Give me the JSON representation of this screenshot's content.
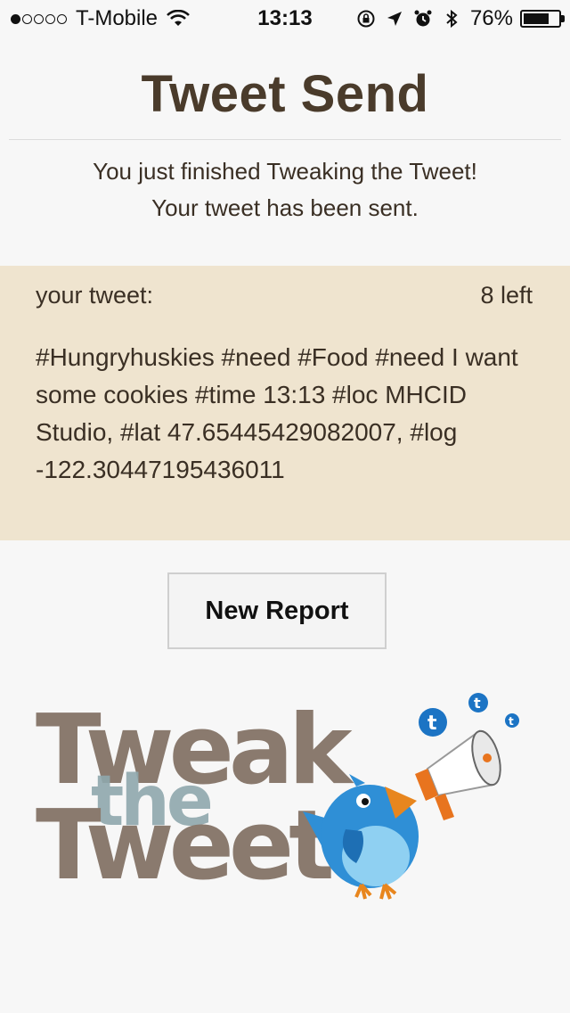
{
  "status_bar": {
    "carrier": "T-Mobile",
    "signal_bars_filled": 1,
    "signal_bars_total": 5,
    "time": "13:13",
    "battery_percent": "76%",
    "battery_level": 0.76
  },
  "header": {
    "title": "Tweet Send"
  },
  "message": {
    "line1": "You just finished Tweaking the Tweet!",
    "line2": "Your tweet has been sent."
  },
  "tweet": {
    "label": "your tweet:",
    "remaining": "8 left",
    "text": "#Hungryhuskies #need #Food #need I want some cookies #time 13:13 #loc MHCID Studio, #lat 47.65445429082007, #log -122.30447195436011"
  },
  "actions": {
    "new_report_label": "New Report"
  },
  "logo": {
    "line1": "Tweak",
    "line2": "the",
    "line3": "Tweet",
    "colors": {
      "text_main": "#8a7a6e",
      "text_the": "#8fa8ad",
      "bird_body": "#2f8fd6",
      "bird_belly": "#8fd0f2",
      "beak": "#e8861e",
      "megaphone": "#e8741e",
      "twitter_bubble": "#1c74c4"
    }
  },
  "colors": {
    "background": "#f7f7f7",
    "panel": "#efe4cf",
    "title": "#4a3b2b",
    "text": "#3a2f24"
  }
}
